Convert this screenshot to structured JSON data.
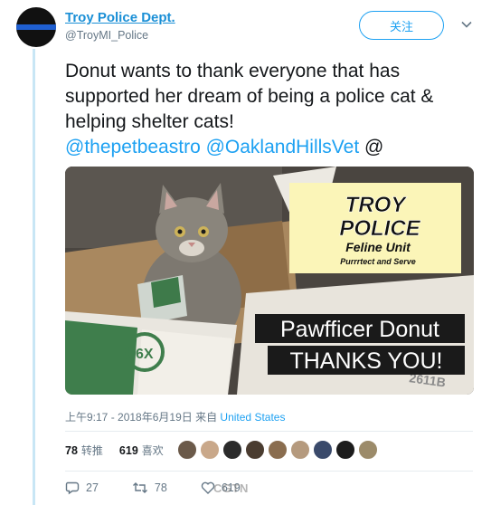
{
  "tweet": {
    "display_name": "Troy Police Dept.",
    "handle": "@TroyMI_Police",
    "follow_label": "关注",
    "text_plain": "Donut wants to thank everyone that has supported her dream of being a police cat & helping shelter cats!",
    "mention_1": "@thepetbeastro",
    "mention_2": "@OaklandHillsVet",
    "mention_3": "@",
    "timestamp": "上午9:17 - 2018年6月19日 来自",
    "location": "United States"
  },
  "media": {
    "sign_line1": "TROY",
    "sign_line2": "POLICE",
    "sign_line3": "Feline Unit",
    "sign_line4": "Purrrtect and Serve",
    "caption_line1": "Pawfficer Donut",
    "caption_line2": "THANKS YOU!",
    "box_text": "6X",
    "box_text_2": "2611B"
  },
  "stats": {
    "retweets_count": "78",
    "retweets_label": "转推",
    "likes_count": "619",
    "likes_label": "喜欢"
  },
  "likers": {
    "colors": [
      "#6b5a4a",
      "#c9a88a",
      "#2b2b2b",
      "#4a3c30",
      "#8a6d4f",
      "#b59a7e",
      "#3a4a6b",
      "#1c1c1c",
      "#9c8b6a"
    ]
  },
  "actions": {
    "reply_count": "27",
    "retweet_count": "78",
    "like_count": "619"
  },
  "watermark": "CGTN",
  "colors": {
    "link": "#1da1f2",
    "name": "#1a8fd6",
    "muted": "#657786"
  }
}
